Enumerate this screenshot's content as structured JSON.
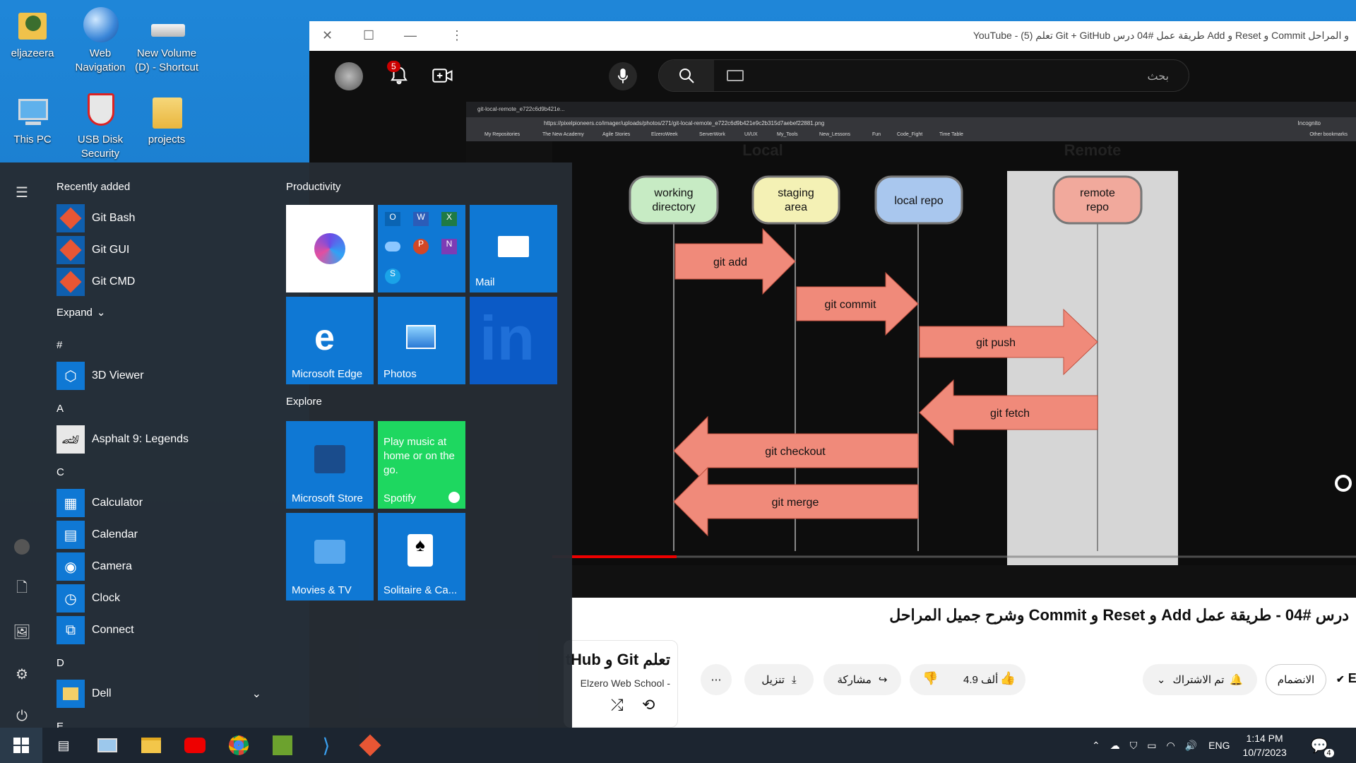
{
  "desktop": {
    "icons": [
      {
        "label": "eljazeera"
      },
      {
        "label": "Web Navigation"
      },
      {
        "label": "New Volume (D) - Shortcut"
      },
      {
        "label": "This PC"
      },
      {
        "label": "USB Disk Security"
      },
      {
        "label": "projects"
      }
    ]
  },
  "start_menu": {
    "recently_added_label": "Recently added",
    "recent_apps": [
      "Git Bash",
      "Git GUI",
      "Git CMD"
    ],
    "expand_label": "Expand",
    "sections": [
      {
        "letter": "#",
        "apps": [
          "3D Viewer"
        ]
      },
      {
        "letter": "A",
        "apps": [
          "Asphalt 9: Legends"
        ]
      },
      {
        "letter": "C",
        "apps": [
          "Calculator",
          "Calendar",
          "Camera",
          "Clock",
          "Connect"
        ]
      },
      {
        "letter": "D",
        "apps": [
          "Dell"
        ]
      },
      {
        "letter": "E",
        "apps": []
      }
    ],
    "productivity_label": "Productivity",
    "explore_label": "Explore",
    "tiles": {
      "mail": "Mail",
      "edge": "Microsoft Edge",
      "photos": "Photos",
      "store": "Microsoft Store",
      "spotify_promo": "Play music at home or on the go.",
      "spotify": "Spotify",
      "movies": "Movies & TV",
      "solitaire": "Solitaire & Ca..."
    }
  },
  "youtube_window": {
    "title": "YouTube - (5) تعلم Git + GitHub طريقة عمل #04 درس Add و Reset و Commit و المراحل",
    "notification_count": "5",
    "search_placeholder": "بحث",
    "video": {
      "browser_tab": "git-local-remote_e722c6d9b421e...",
      "url": "https://pixelpioneers.co/imager/uploads/photos/271/git-local-remote_e722c6d9b421e9c2b315d7aebef22881.png",
      "incognito": "Incognito",
      "bookmarks": [
        "My Repositories",
        "The New Academy",
        "Agile Stories",
        "ElzeroWeek",
        "ServerWork",
        "UI/UX",
        "My_Tools",
        "New_Lessons",
        "Fun",
        "Code_Fight",
        "Time Table"
      ],
      "other_bookmarks": "Other bookmarks",
      "heading_local": "Local",
      "heading_remote": "Remote",
      "nodes": [
        "working directory",
        "staging area",
        "local repo",
        "remote repo"
      ],
      "arrows": [
        "git add",
        "git commit",
        "git push",
        "git fetch",
        "git checkout",
        "git merge"
      ]
    },
    "video_title": "درس #04 - طريقة عمل Add و Reset و Commit وشرح جميل المراحل",
    "channel": "Elzero",
    "join_label": "الانضمام",
    "subscribed_label": "تم الاشتراك",
    "likes": "4.9 ألف",
    "share_label": "مشاركة",
    "download_label": "تنزيل",
    "playlist_title": "تعلم Git و GitHub",
    "playlist_channel": "Elzero Web School -"
  },
  "taskbar": {
    "language": "ENG",
    "time": "1:14 PM",
    "date": "10/7/2023",
    "notifications": "4"
  }
}
